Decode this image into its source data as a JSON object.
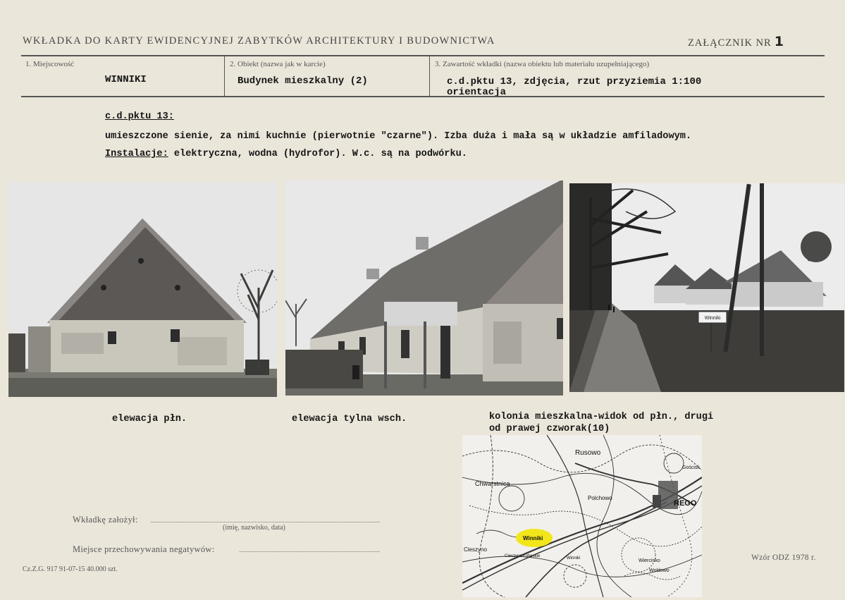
{
  "header": {
    "title": "WKŁADKA DO KARTY EWIDENCYJNEJ ZABYTKÓW ARCHITEKTURY I BUDOWNICTWA",
    "annex_label": "ZAŁĄCZNIK NR",
    "annex_number": "1"
  },
  "fields": {
    "f1_label": "1. Miejscowość",
    "f1_value": "WINNIKI",
    "f2_label": "2. Obiekt (nazwa jak w karcie)",
    "f2_value": "Budynek mieszkalny (2)",
    "f3_label": "3. Zawartość wkładki (nazwa obiektu lub materiału uzupełniającego)",
    "f3_value_1": "c.d.pktu 13, zdjęcia, rzut przyziemia 1:100",
    "f3_value_2": "orientacja"
  },
  "body": {
    "heading": "c.d.pktu 13:",
    "line1": "umieszczone sienie, za nimi kuchnie (pierwotnie \"czarne\"). Izba duża i mała są w układzie amfiladowym.",
    "install_label": "Instalacje:",
    "install_text": " elektryczna, wodna (hydrofor). W.c. są na podwórku."
  },
  "captions": {
    "photo1": "elewacja płn.",
    "photo2": "elewacja tylna wsch.",
    "photo3_1": "kolonia mieszkalna-widok od płn., drugi",
    "photo3_2": "od prawej czworak(10)"
  },
  "map_labels": {
    "rusowo": "Rusowo",
    "goscisk": "Gościsk",
    "chwarstnica": "Chwarstnica",
    "polchowo": "Polchowo",
    "trzebiatow": "REGO",
    "winniki": "Winniki",
    "cieszyno": "Cieszyno",
    "lobeskie": "Cieszyno Łobeskie",
    "wiercinko": "Wiercinko",
    "woldowo": "Woldowo",
    "winniki2": "Winniki"
  },
  "sign_text": "Winniki",
  "footer": {
    "founded_label": "Wkładkę założył:",
    "founded_hint": "(imię, nazwisko, data)",
    "storage_label": "Miejsce przechowywania negatywów:",
    "print_info": "Cz.Z.G. 917 91-07-15 40.000 szt.",
    "form_model": "Wzór ODZ 1978 r."
  },
  "colors": {
    "paper": "#ebe6da",
    "highlight": "#f2e61a"
  }
}
